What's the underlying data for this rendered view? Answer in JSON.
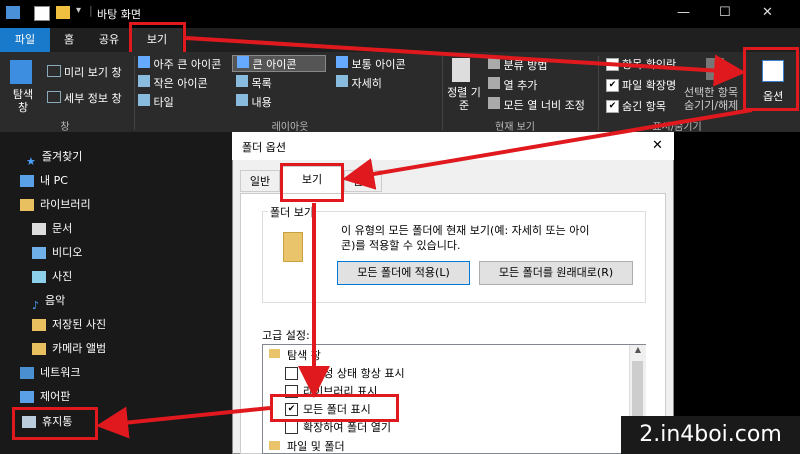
{
  "window": {
    "title": "바탕 화면"
  },
  "tabs": [
    "파일",
    "홈",
    "공유",
    "보기"
  ],
  "ribbon": {
    "panes": {
      "nav_label": "탐색 창",
      "preview": "미리 보기 창",
      "details": "세부 정보 창",
      "group": "창"
    },
    "layout": {
      "items": [
        "아주 큰 아이콘",
        "큰 아이콘",
        "보통 아이콘",
        "작은 아이콘",
        "목록",
        "자세히",
        "타일",
        "내용"
      ],
      "group": "레이아웃"
    },
    "current_view": {
      "sort": "정렬 기준",
      "group_by": "분류 방법",
      "add_column": "열 추가",
      "fit_columns": "모든 열 너비 조정",
      "group": "현재 보기"
    },
    "show_hide": {
      "item_checkbox": "항목 확인란",
      "extensions": "파일 확장명",
      "hidden": "숨긴 항목",
      "hide_selected": "선택한 항목 숨기기/해제",
      "group": "표시/숨기기"
    },
    "options": {
      "label": "옵션"
    }
  },
  "sidebar": {
    "items": [
      "즐겨찾기",
      "내 PC",
      "라이브러리",
      "문서",
      "비디오",
      "사진",
      "음악",
      "저장된 사진",
      "카메라 앨범",
      "네트워크",
      "제어판",
      "휴지통"
    ]
  },
  "dialog": {
    "title": "폴더 옵션",
    "close": "✕",
    "tabs": [
      "일반",
      "보기",
      "검색"
    ],
    "folder_views": {
      "legend": "폴더 보기",
      "description_1": "이 유형의 모든 폴더에 현재 보기(예: 자세히 또는 아이",
      "description_2": "콘)를 적용할 수 있습니다.",
      "apply_button": "모든 폴더에 적용(L)",
      "reset_button": "모든 폴더를 원래대로(R)"
    },
    "advanced": {
      "label": "고급 설정:",
      "items": [
        {
          "label": "탐색 창",
          "type": "folder"
        },
        {
          "label": "사용성 상태 항상 표시",
          "type": "checkbox",
          "checked": false
        },
        {
          "label": "라이브러리 표시",
          "type": "checkbox",
          "checked": false
        },
        {
          "label": "모든 폴더 표시",
          "type": "checkbox",
          "checked": true
        },
        {
          "label": "확장하여 폴더 열기",
          "type": "checkbox",
          "checked": false
        },
        {
          "label": "파일 및 폴더",
          "type": "folder"
        }
      ]
    }
  },
  "watermark": "2.in4boi.com",
  "colors": {
    "highlight": "#e0191e",
    "file_tab": "#1979ca",
    "accent": "#0078d7"
  }
}
